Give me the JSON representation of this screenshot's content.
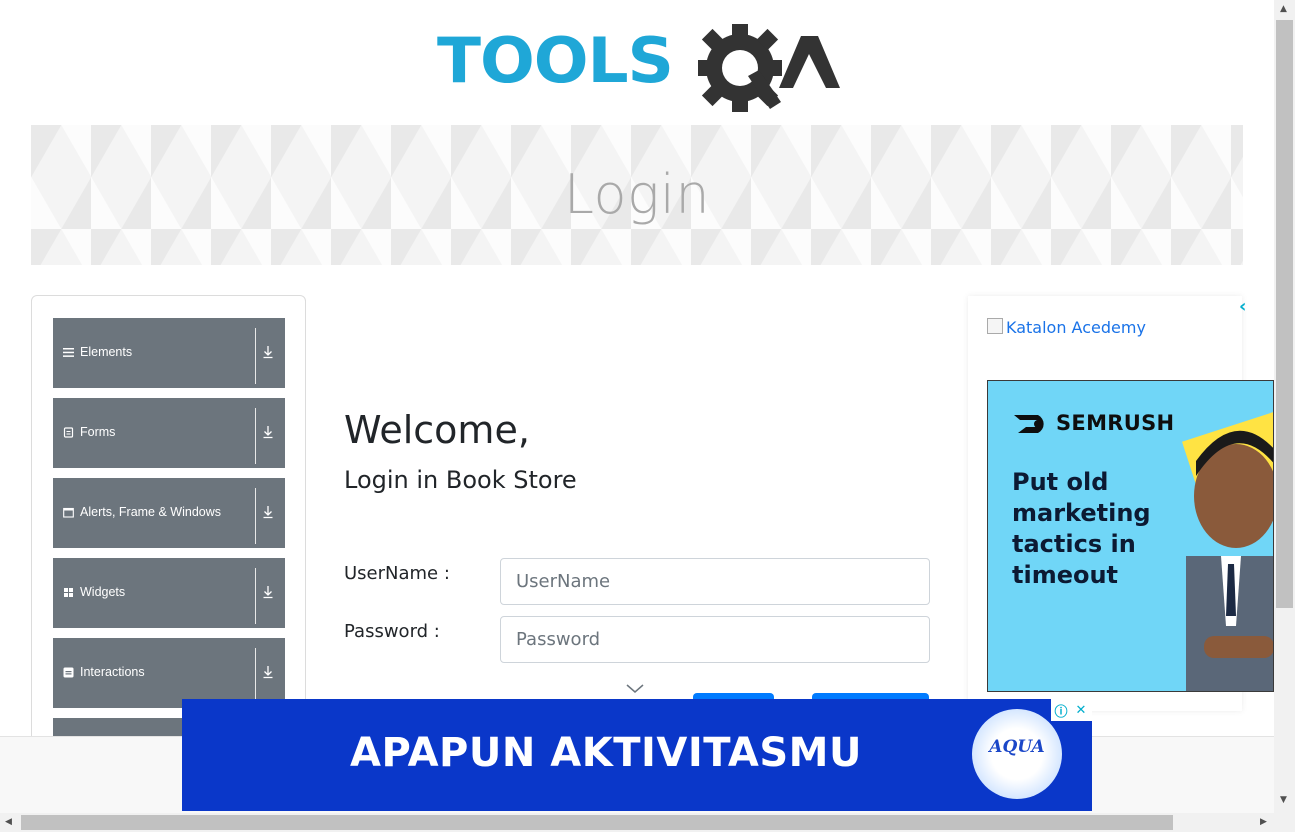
{
  "logo": {
    "word": "TOOLS",
    "suffix": "A"
  },
  "banner": {
    "title": "Login"
  },
  "sidebar": {
    "groups": [
      {
        "label": "Elements",
        "icon": "hamburger-icon"
      },
      {
        "label": "Forms",
        "icon": "form-icon"
      },
      {
        "label": "Alerts, Frame & Windows",
        "icon": "window-icon"
      },
      {
        "label": "Widgets",
        "icon": "grid-icon"
      },
      {
        "label": "Interactions",
        "icon": "interaction-icon"
      }
    ]
  },
  "main": {
    "welcome": "Welcome,",
    "subheading": "Login in Book Store",
    "username_label": "UserName :",
    "username_placeholder": "UserName",
    "password_label": "Password :",
    "password_placeholder": "Password"
  },
  "ad_right": {
    "broken_image_alt": "Katalon Acedemy",
    "brand": "SEMRUSH",
    "headline": "Put old marketing tactics in timeout",
    "close_symbol": "‹"
  },
  "ad_bottom": {
    "text": "APAPUN AKTIVITASMU",
    "badge": "AQUA",
    "info_symbol": "ⓘ",
    "close_symbol": "✕"
  },
  "colors": {
    "sidebar_header": "#6c757d",
    "logo_blue": "#1fa7d7",
    "logo_dark": "#333333",
    "primary_button": "#007bff",
    "ad_bottom_bg": "#0a37c9",
    "semrush_bg": "#70d6f7"
  }
}
